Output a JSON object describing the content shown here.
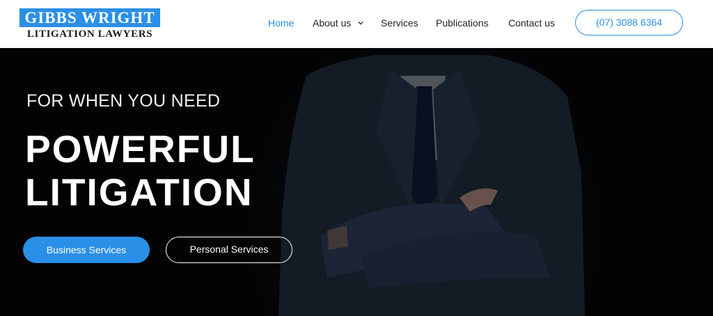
{
  "brand": {
    "name_line1": "GIBBS WRIGHT",
    "name_line2": "LITIGATION LAWYERS",
    "accent_color": "#2a8fe6"
  },
  "nav": {
    "items": [
      {
        "label": "Home",
        "active": true
      },
      {
        "label": "About us",
        "has_dropdown": true,
        "icon": "chevron-down-icon"
      },
      {
        "label": "Services"
      },
      {
        "label": "Publications"
      },
      {
        "label": "Contact us"
      }
    ],
    "phone": "(07) 3088 6364"
  },
  "hero": {
    "subtitle": "FOR WHEN YOU NEED",
    "title_line1": "POWERFUL",
    "title_line2": "LITIGATION",
    "primary_button": "Business Services",
    "secondary_button": "Personal Services"
  }
}
